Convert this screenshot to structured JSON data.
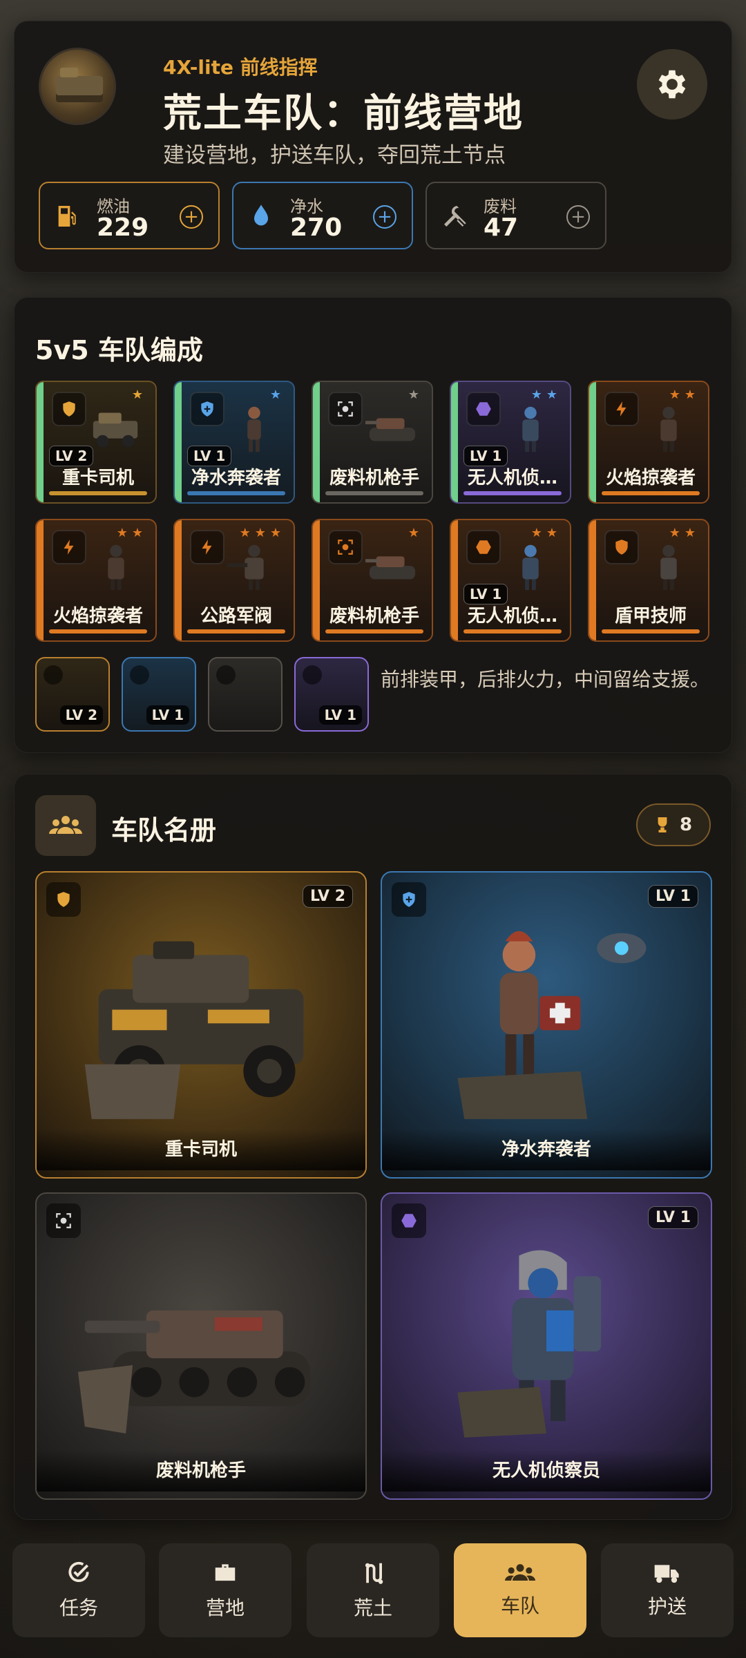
{
  "header": {
    "subtitle": "4X-lite 前线指挥",
    "title": "荒土车队：前线营地",
    "description": "建设营地，护送车队，夺回荒土节点",
    "settings_icon": "gear-icon"
  },
  "resources": [
    {
      "label": "燃油",
      "value": "229",
      "icon": "fuel-icon",
      "color": "#e6a53a"
    },
    {
      "label": "净水",
      "value": "270",
      "icon": "water-drop-icon",
      "color": "#5aa4e8"
    },
    {
      "label": "废料",
      "value": "47",
      "icon": "tools-icon",
      "color": "#9b958b"
    }
  ],
  "formation": {
    "title": "5v5 车队编成",
    "row1": [
      {
        "name": "重卡司机",
        "level": "LV 2",
        "stars": "★",
        "class": "shield"
      },
      {
        "name": "净水奔袭者",
        "level": "LV 1",
        "stars": "★",
        "class": "shield-plus"
      },
      {
        "name": "废料机枪手",
        "level": "",
        "stars": "★",
        "class": "target"
      },
      {
        "name": "无人机侦…",
        "level": "LV 1",
        "stars": "★★",
        "class": "hex"
      },
      {
        "name": "火焰掠袭者",
        "level": "",
        "stars": "★★",
        "class": "bolt"
      }
    ],
    "row2": [
      {
        "name": "火焰掠袭者",
        "level": "",
        "stars": "★★",
        "class": "bolt"
      },
      {
        "name": "公路军阀",
        "level": "",
        "stars": "★★★",
        "class": "bolt"
      },
      {
        "name": "废料机枪手",
        "level": "",
        "stars": "★",
        "class": "target"
      },
      {
        "name": "无人机侦…",
        "level": "LV 1",
        "stars": "★★",
        "class": "hex"
      },
      {
        "name": "盾甲技师",
        "level": "",
        "stars": "★★",
        "class": "shield"
      }
    ],
    "bench": [
      {
        "level": "LV 2"
      },
      {
        "level": "LV 1"
      },
      {
        "level": ""
      },
      {
        "level": "LV 1"
      }
    ],
    "tip": "前排装甲，后排火力，中间留给支援。"
  },
  "roster": {
    "title": "车队名册",
    "trophy_count": "8",
    "cards": [
      {
        "name": "重卡司机",
        "level": "LV 2"
      },
      {
        "name": "净水奔袭者",
        "level": "LV 1"
      },
      {
        "name": "废料机枪手",
        "level": ""
      },
      {
        "name": "无人机侦察员",
        "level": "LV 1"
      }
    ]
  },
  "nav": [
    {
      "label": "任务",
      "icon": "check-circle-icon"
    },
    {
      "label": "营地",
      "icon": "toolbox-icon"
    },
    {
      "label": "荒土",
      "icon": "route-icon"
    },
    {
      "label": "车队",
      "icon": "team-icon",
      "active": true
    },
    {
      "label": "护送",
      "icon": "truck-icon"
    }
  ],
  "colors": {
    "accent": "#e6a53a",
    "gold": "#c8922f",
    "blue": "#3b78b2",
    "purple": "#8a6ad8",
    "orange": "#e07a22",
    "green": "#6fcf8b"
  }
}
